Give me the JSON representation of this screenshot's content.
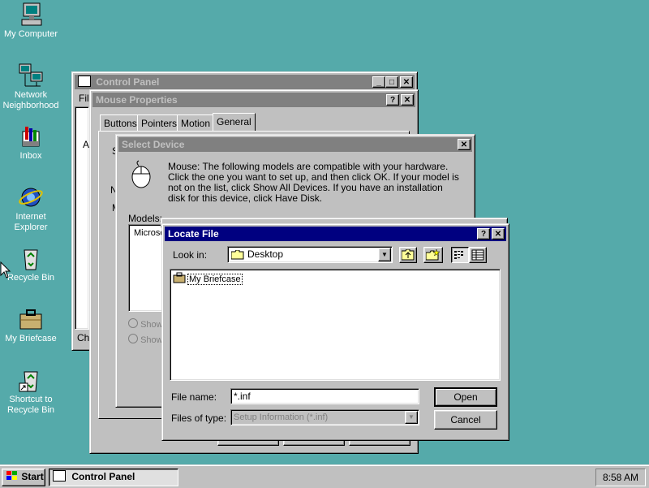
{
  "desktop": {
    "icons": [
      {
        "label": "My Computer"
      },
      {
        "label": "Network Neighborhood"
      },
      {
        "label": "Inbox"
      },
      {
        "label": "Internet Explorer"
      },
      {
        "label": "Recycle Bin"
      },
      {
        "label": "My Briefcase"
      },
      {
        "label": "Shortcut to Recycle Bin"
      }
    ]
  },
  "control_panel": {
    "title": "Control Panel",
    "menu_partial": "Fil",
    "side_char": "A",
    "status_partial": "Ch"
  },
  "mouse_properties": {
    "title": "Mouse Properties",
    "tabs": [
      "Buttons",
      "Pointers",
      "Motion",
      "General"
    ],
    "partial_S": "S",
    "partial_N": "N",
    "partial_M": "M"
  },
  "select_device": {
    "title": "Select Device",
    "message": "Mouse: The following models are compatible with your hardware. Click the one you want to set up, and then click OK. If your model is not on the list, click Show All Devices. If you have an installation disk for this device, click Have Disk.",
    "models_label": "Models:",
    "models_partial": "Microso",
    "radio1_partial": "Show",
    "radio2_partial": "Show"
  },
  "locate_file": {
    "title": "Locate File",
    "look_in_label": "Look in:",
    "look_in_value": "Desktop",
    "files": [
      {
        "name": "My Briefcase"
      }
    ],
    "file_name_label": "File name:",
    "file_name_value": "*.inf",
    "files_of_type_label": "Files of type:",
    "files_of_type_value": "Setup Information (*.inf)",
    "open_label": "Open",
    "cancel_label": "Cancel"
  },
  "taskbar": {
    "start_label": "Start",
    "task_label": "Control Panel",
    "clock": "8:58 AM"
  }
}
